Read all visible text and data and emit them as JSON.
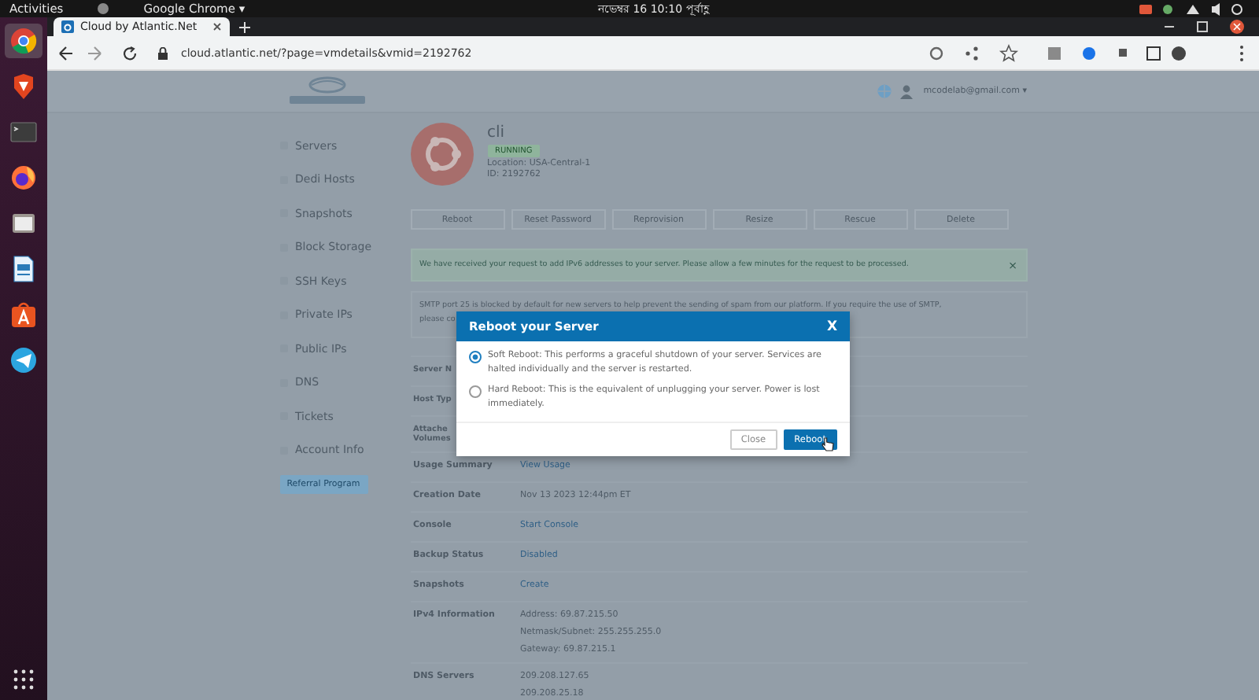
{
  "desktop_bar": {
    "activities": "Activities",
    "app_menu": "Google Chrome ▾",
    "clock": "নভেম্বর 16  10:10 পূর্বাহ্ণ"
  },
  "dock": [
    {
      "kind": "chrome",
      "selected": true
    },
    {
      "kind": "brave",
      "selected": false
    },
    {
      "kind": "terminal",
      "selected": false
    },
    {
      "kind": "firefox",
      "selected": false
    },
    {
      "kind": "files",
      "selected": false
    },
    {
      "kind": "writer",
      "selected": false
    },
    {
      "kind": "store",
      "selected": false
    },
    {
      "kind": "telegram",
      "selected": false
    },
    {
      "kind": "grid",
      "selected": false
    }
  ],
  "browser": {
    "tab_title": "Cloud by Atlantic.Net",
    "url": "cloud.atlantic.net/?page=vmdetails&vmid=2192762"
  },
  "page": {
    "user_email": "mcodelab@gmail.com ▾",
    "sidebar": {
      "items": [
        "Servers",
        "Dedi Hosts",
        "Snapshots",
        "Block Storage",
        "SSH Keys",
        "Private IPs",
        "Public IPs",
        "DNS",
        "Tickets",
        "Account Info"
      ],
      "referral": "Referral Program"
    },
    "server": {
      "name": "cli",
      "status": "RUNNING",
      "location": "Location: USA-Central-1",
      "id": "ID: 2192762"
    },
    "actions": [
      "Reboot",
      "Reset Password",
      "Reprovision",
      "Resize",
      "Rescue",
      "Delete"
    ],
    "alert": "We have received your request to add IPv6 addresses to your server. Please allow a few minutes for the request to be processed.",
    "alert_close": "×",
    "notice": "SMTP port 25 is blocked by default for new servers to help prevent the sending of spam from our platform. If you require the use of SMTP,",
    "notice_cont": "please co",
    "details": [
      {
        "label": "Server N"
      },
      {
        "label": "Host Typ"
      },
      {
        "label": "Attache Volumes"
      },
      {
        "label": "Usage Summary",
        "values": [
          {
            "text": "View Usage",
            "link": true
          }
        ]
      },
      {
        "label": "Creation Date",
        "values": [
          {
            "text": "Nov 13 2023 12:44pm ET",
            "link": false
          }
        ]
      },
      {
        "label": "Console",
        "values": [
          {
            "text": "Start Console",
            "link": true
          }
        ]
      },
      {
        "label": "Backup Status",
        "values": [
          {
            "text": "Disabled",
            "link": true
          }
        ]
      },
      {
        "label": "Snapshots",
        "values": [
          {
            "text": "Create",
            "link": true
          }
        ]
      },
      {
        "label": "IPv4 Information",
        "values": [
          {
            "text": "Address: 69.87.215.50",
            "link": false
          },
          {
            "text": "Netmask/Subnet: 255.255.255.0",
            "link": false
          },
          {
            "text": "Gateway: 69.87.215.1",
            "link": false
          }
        ]
      },
      {
        "label": "DNS Servers",
        "values": [
          {
            "text": "209.208.127.65",
            "link": false
          },
          {
            "text": "209.208.25.18",
            "link": false
          }
        ]
      }
    ]
  },
  "reboot_dialog": {
    "title": "Reboot your Server",
    "close": "X",
    "options": [
      {
        "text": "Soft Reboot: This performs a graceful shutdown of your server. Services are halted individually and the server is restarted.",
        "selected": true
      },
      {
        "text": "Hard Reboot: This is the equivalent of unplugging your server. Power is lost immediately.",
        "selected": false
      }
    ],
    "buttons": [
      {
        "label": "Close",
        "kind": "default"
      },
      {
        "label": "Reboot",
        "kind": "primary"
      }
    ]
  }
}
